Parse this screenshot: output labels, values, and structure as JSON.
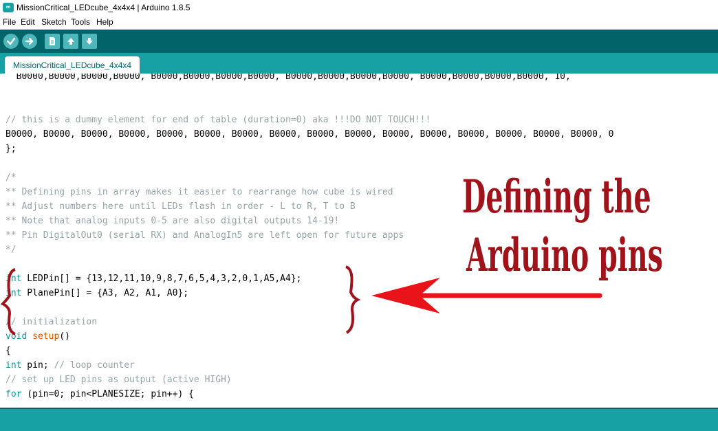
{
  "window": {
    "title": "MissionCritical_LEDcube_4x4x4 | Arduino 1.8.5",
    "app_icon": "arduino-logo-icon",
    "app_icon_glyph": "∞"
  },
  "menubar": {
    "items": [
      {
        "label": "File"
      },
      {
        "label": "Edit"
      },
      {
        "label": "Sketch"
      },
      {
        "label": "Tools"
      },
      {
        "label": "Help"
      }
    ]
  },
  "toolbar": {
    "buttons": [
      {
        "name": "verify",
        "icon": "checkmark-icon"
      },
      {
        "name": "upload",
        "icon": "arrow-right-icon"
      },
      {
        "name": "new",
        "icon": "new-file-icon"
      },
      {
        "name": "open",
        "icon": "arrow-up-icon"
      },
      {
        "name": "save",
        "icon": "arrow-down-icon"
      }
    ]
  },
  "tabs": [
    {
      "label": "MissionCritical_LEDcube_4x4x4",
      "active": true
    }
  ],
  "editor": {
    "lines": [
      "  B0000,B0000,B0000,B0000, B0000,B0000,B0000,B0000, B0000,B0000,B0000,B0000, B0000,B0000,B0000,B0000, 10,",
      "",
      "",
      "// this is a dummy element for end of table (duration=0) aka !!!DO NOT TOUCH!!!",
      "B0000, B0000, B0000, B0000, B0000, B0000, B0000, B0000, B0000, B0000, B0000, B0000, B0000, B0000, B0000, B0000, 0",
      "};",
      "",
      "/*",
      "** Defining pins in array makes it easier to rearrange how cube is wired",
      "** Adjust numbers here until LEDs flash in order - L to R, T to B",
      "** Note that analog inputs 0-5 are also digital outputs 14-19!",
      "** Pin DigitalOut0 (serial RX) and AnalogIn5 are left open for future apps",
      "*/",
      "",
      "int LEDPin[] = {13,12,11,10,9,8,7,6,5,4,3,2,0,1,A5,A4};",
      "int PlanePin[] = {A3, A2, A1, A0};",
      "",
      "// initialization",
      "void setup()",
      "{",
      "int pin; // loop counter",
      "// set up LED pins as output (active HIGH)",
      "for (pin=0; pin<PLANESIZE; pin++) {"
    ]
  },
  "annotation": {
    "line1": "Defining the",
    "line2": "Arduino pins",
    "color": "#a0131b",
    "arrow_color": "#e8141a"
  },
  "colors": {
    "toolbar": "#006468",
    "tabstrip": "#17a1a5",
    "button": "#4db7bb",
    "comment": "#95a5a6",
    "keyword": "#00979c",
    "function": "#d35400"
  }
}
